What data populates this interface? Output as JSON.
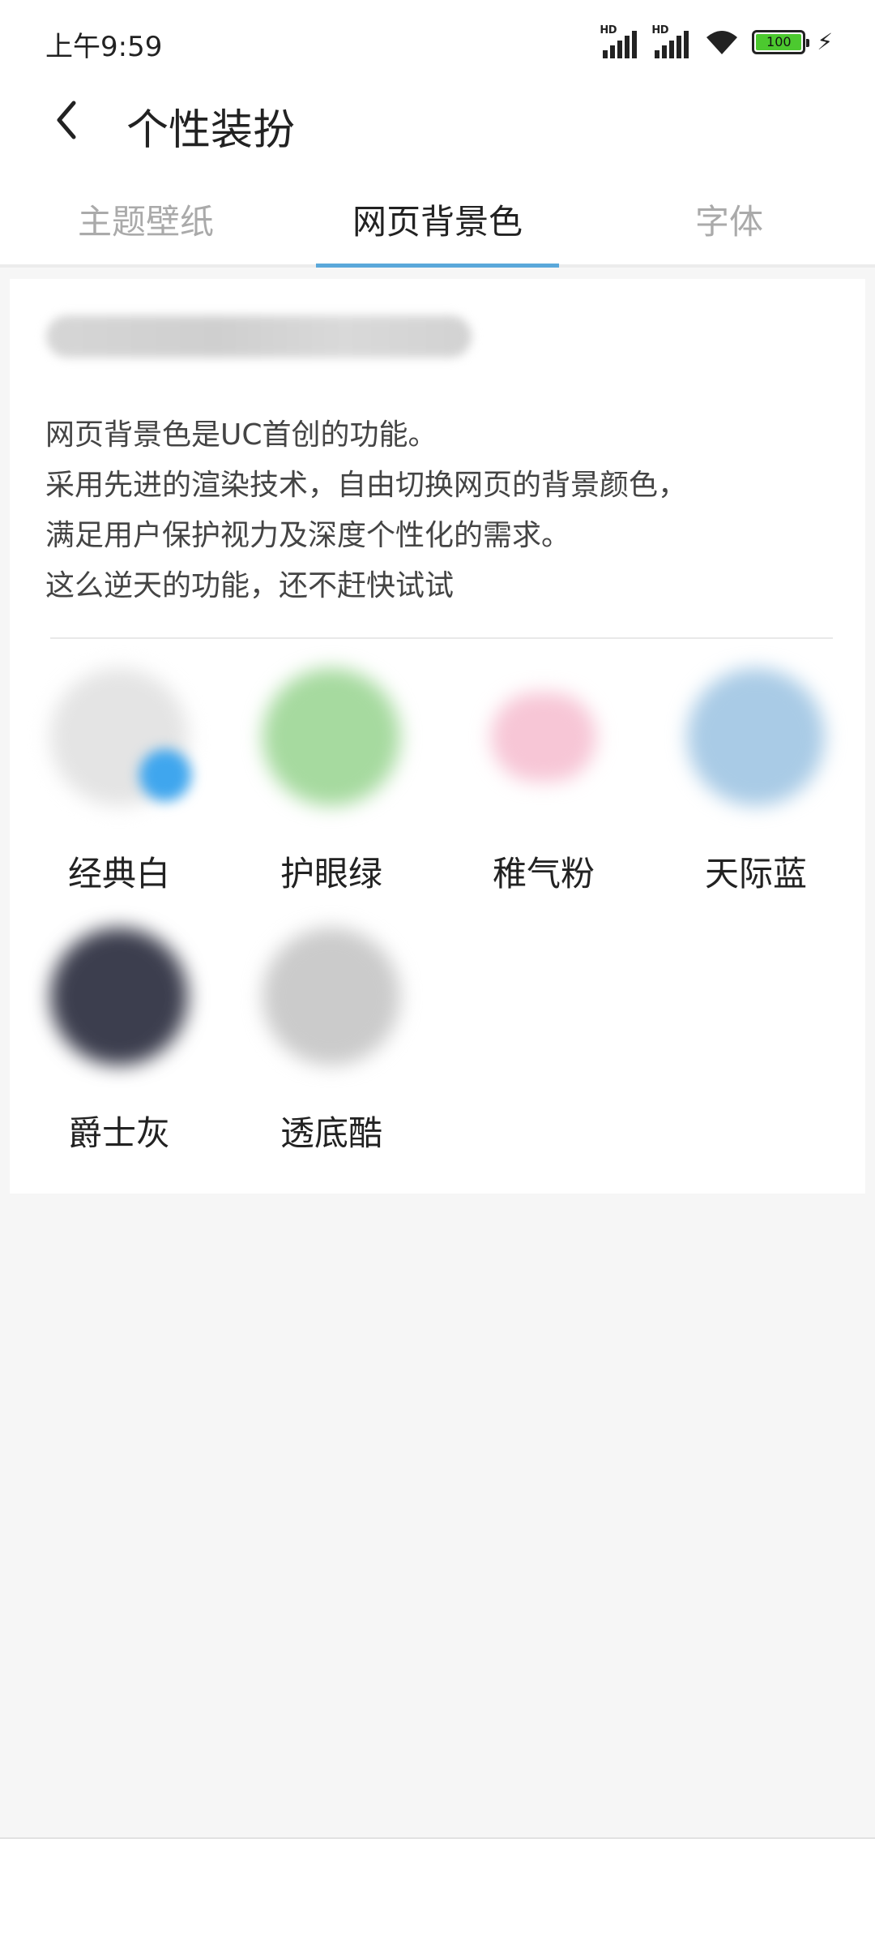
{
  "status_bar": {
    "time": "上午9:59",
    "signal1_label": "HD",
    "signal2_label": "HD",
    "battery_level": "100"
  },
  "header": {
    "title": "个性装扮"
  },
  "tabs": [
    {
      "label": "主题壁纸",
      "active": false
    },
    {
      "label": "网页背景色",
      "active": true
    },
    {
      "label": "字体",
      "active": false
    }
  ],
  "content": {
    "description": [
      "网页背景色是UC首创的功能。",
      "采用先进的渲染技术，自由切换网页的背景颜色，",
      "满足用户保护视力及深度个性化的需求。",
      "这么逆天的功能，还不赶快试试"
    ],
    "swatches": [
      {
        "label": "经典白",
        "color": "#d7d7d7",
        "selected": true
      },
      {
        "label": "护眼绿",
        "color": "#9fd79c"
      },
      {
        "label": "稚气粉",
        "color": "#f4b6cb"
      },
      {
        "label": "天际蓝",
        "color": "#a7cbe8"
      },
      {
        "label": "爵士灰",
        "color": "#3f4150"
      },
      {
        "label": "透底酷",
        "color": "#c9c9c9"
      }
    ]
  },
  "colors": {
    "accent": "#5aa8da",
    "selected_check": "#3fa6ee"
  }
}
